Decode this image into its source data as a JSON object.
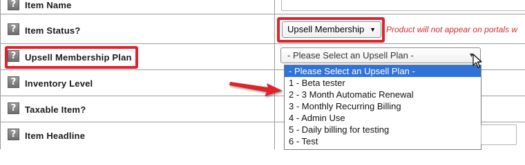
{
  "form": {
    "help_icon_glyph": "?",
    "rows": [
      {
        "label": "Item Name"
      },
      {
        "label": "Item Status?"
      },
      {
        "label": "Upsell Membership Plan"
      },
      {
        "label": "Inventory Level"
      },
      {
        "label": "Taxable Item?"
      },
      {
        "label": "Item Headline"
      }
    ],
    "item_status": {
      "selected": "Upsell Membership",
      "note": "Product will not appear on portals w"
    },
    "upsell_plan": {
      "selected": "- Please Select an Upsell Plan -",
      "options": [
        "- Please Select an Upsell Plan -",
        "1 - Beta tester",
        "2 - 3 Month Automatic Renewal",
        "3 - Monthly Recurring Billing",
        "4 - Admin Use",
        "5 - Daily billing for testing",
        "6 - Test"
      ]
    }
  },
  "colors": {
    "highlight": "#e0232a",
    "selected_option": "#2f73d8",
    "note_text": "#d42a2a",
    "arrow": "#e0232a"
  },
  "icons": {
    "help": "question-mark-icon",
    "caret": "caret-down-icon",
    "cursor": "mouse-pointer-icon",
    "arrow": "red-arrow-annotation"
  }
}
